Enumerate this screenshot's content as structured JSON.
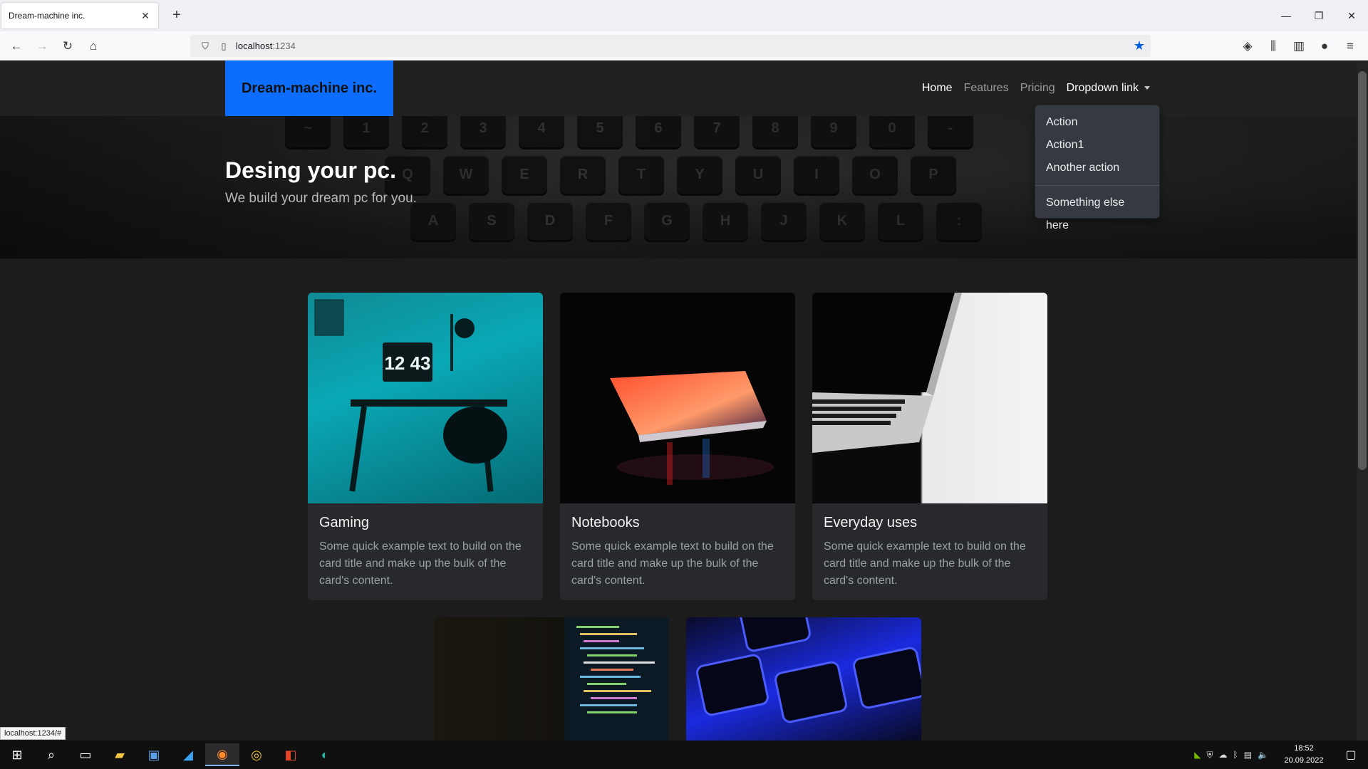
{
  "browser": {
    "tab_title": "Dream-machine inc.",
    "tab_close": "✕",
    "new_tab": "+",
    "url_host": "localhost",
    "url_port": ":1234",
    "status_url": "localhost:1234/#",
    "window_controls": {
      "minimize": "—",
      "restore": "❐",
      "close": "✕"
    }
  },
  "site": {
    "brand": "Dream-machine inc.",
    "nav": [
      {
        "label": "Home",
        "active": true
      },
      {
        "label": "Features"
      },
      {
        "label": "Pricing"
      },
      {
        "label": "Dropdown link"
      }
    ],
    "dropdown": [
      "Action",
      "Action1",
      "Another action",
      "Something else here"
    ],
    "hero": {
      "title": "Desing your pc.",
      "subtitle": "We build your dream pc for you."
    },
    "cards": [
      {
        "title": "Gaming",
        "text": "Some quick example text to build on the card title and make up the bulk of the card's content."
      },
      {
        "title": "Notebooks",
        "text": "Some quick example text to build on the card title and make up the bulk of the card's content."
      },
      {
        "title": "Everyday uses",
        "text": "Some quick example text to build on the card title and make up the bulk of the card's content."
      }
    ],
    "keyboard_rows": [
      [
        "~",
        "1",
        "2",
        "3",
        "4",
        "5",
        "6",
        "7",
        "8",
        "9",
        "0",
        "-"
      ],
      [
        "Q",
        "W",
        "E",
        "R",
        "T",
        "Y",
        "U",
        "I",
        "O",
        "P"
      ],
      [
        "A",
        "S",
        "D",
        "F",
        "G",
        "H",
        "J",
        "K",
        "L",
        ":"
      ]
    ],
    "gaming_clock": "12 43"
  },
  "taskbar": {
    "time": "18:52",
    "date": "20.09.2022"
  },
  "colors": {
    "brand_blue": "#0d6efd",
    "page_bg": "#1c1c1d",
    "card_bg": "#27292c",
    "bookmark_star": "#0060df"
  }
}
